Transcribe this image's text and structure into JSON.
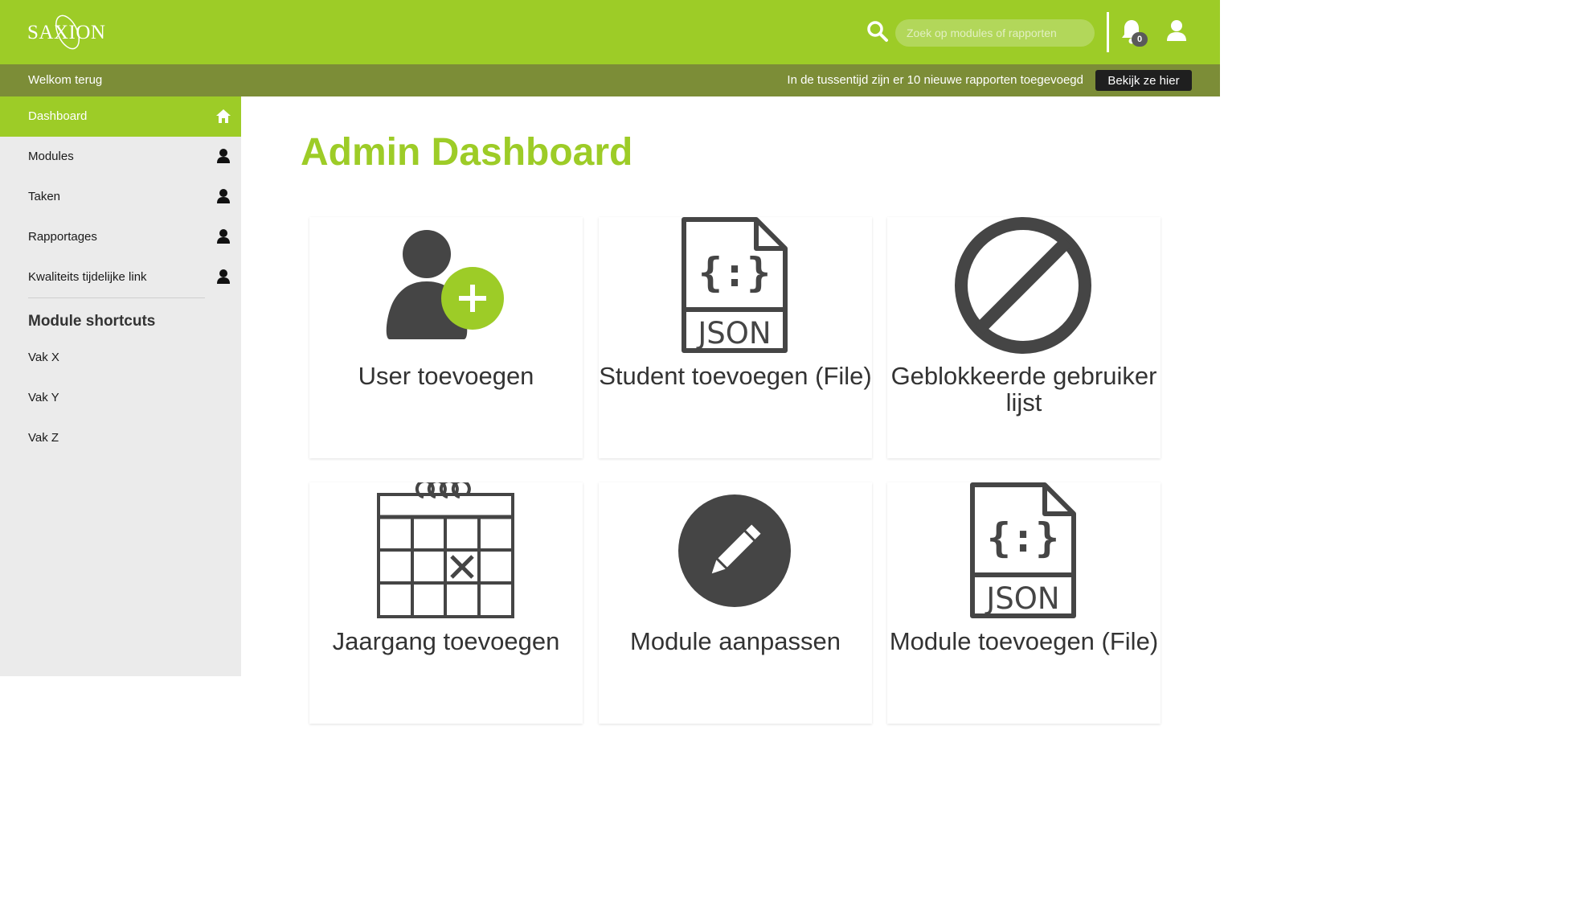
{
  "header": {
    "logo_text": "SAXION",
    "search_placeholder": "Zoek op modules of rapporten",
    "notification_count": "0"
  },
  "subbar": {
    "welcome": "Welkom terug",
    "notice": "In de tussentijd zijn er 10 nieuwe rapporten toegevoegd",
    "button_label": "Bekijk ze hier"
  },
  "sidebar": {
    "items": [
      {
        "label": "Dashboard",
        "icon": "home-icon",
        "active": true
      },
      {
        "label": "Modules",
        "icon": "user-icon"
      },
      {
        "label": "Taken",
        "icon": "user-icon"
      },
      {
        "label": "Rapportages",
        "icon": "user-icon"
      },
      {
        "label": "Kwaliteits tijdelijke link",
        "icon": "user-icon"
      }
    ],
    "shortcuts_title": "Module shortcuts",
    "shortcuts": [
      "Vak X",
      "Vak Y",
      "Vak Z"
    ]
  },
  "main": {
    "title": "Admin Dashboard",
    "cards": [
      {
        "label": "User toevoegen",
        "icon": "add-user-icon"
      },
      {
        "label": "Student toevoegen (File)",
        "icon": "json-file-icon"
      },
      {
        "label": "Geblokkeerde gebruiker lijst",
        "icon": "blocked-icon"
      },
      {
        "label": "Jaargang toevoegen",
        "icon": "calendar-icon"
      },
      {
        "label": "Module aanpassen",
        "icon": "edit-icon"
      },
      {
        "label": "Module toevoegen (File)",
        "icon": "json-file-icon"
      }
    ],
    "json_badge": "JSON"
  },
  "colors": {
    "accent": "#9dcc27",
    "subbar": "#7c8d37",
    "icon": "#454545"
  }
}
